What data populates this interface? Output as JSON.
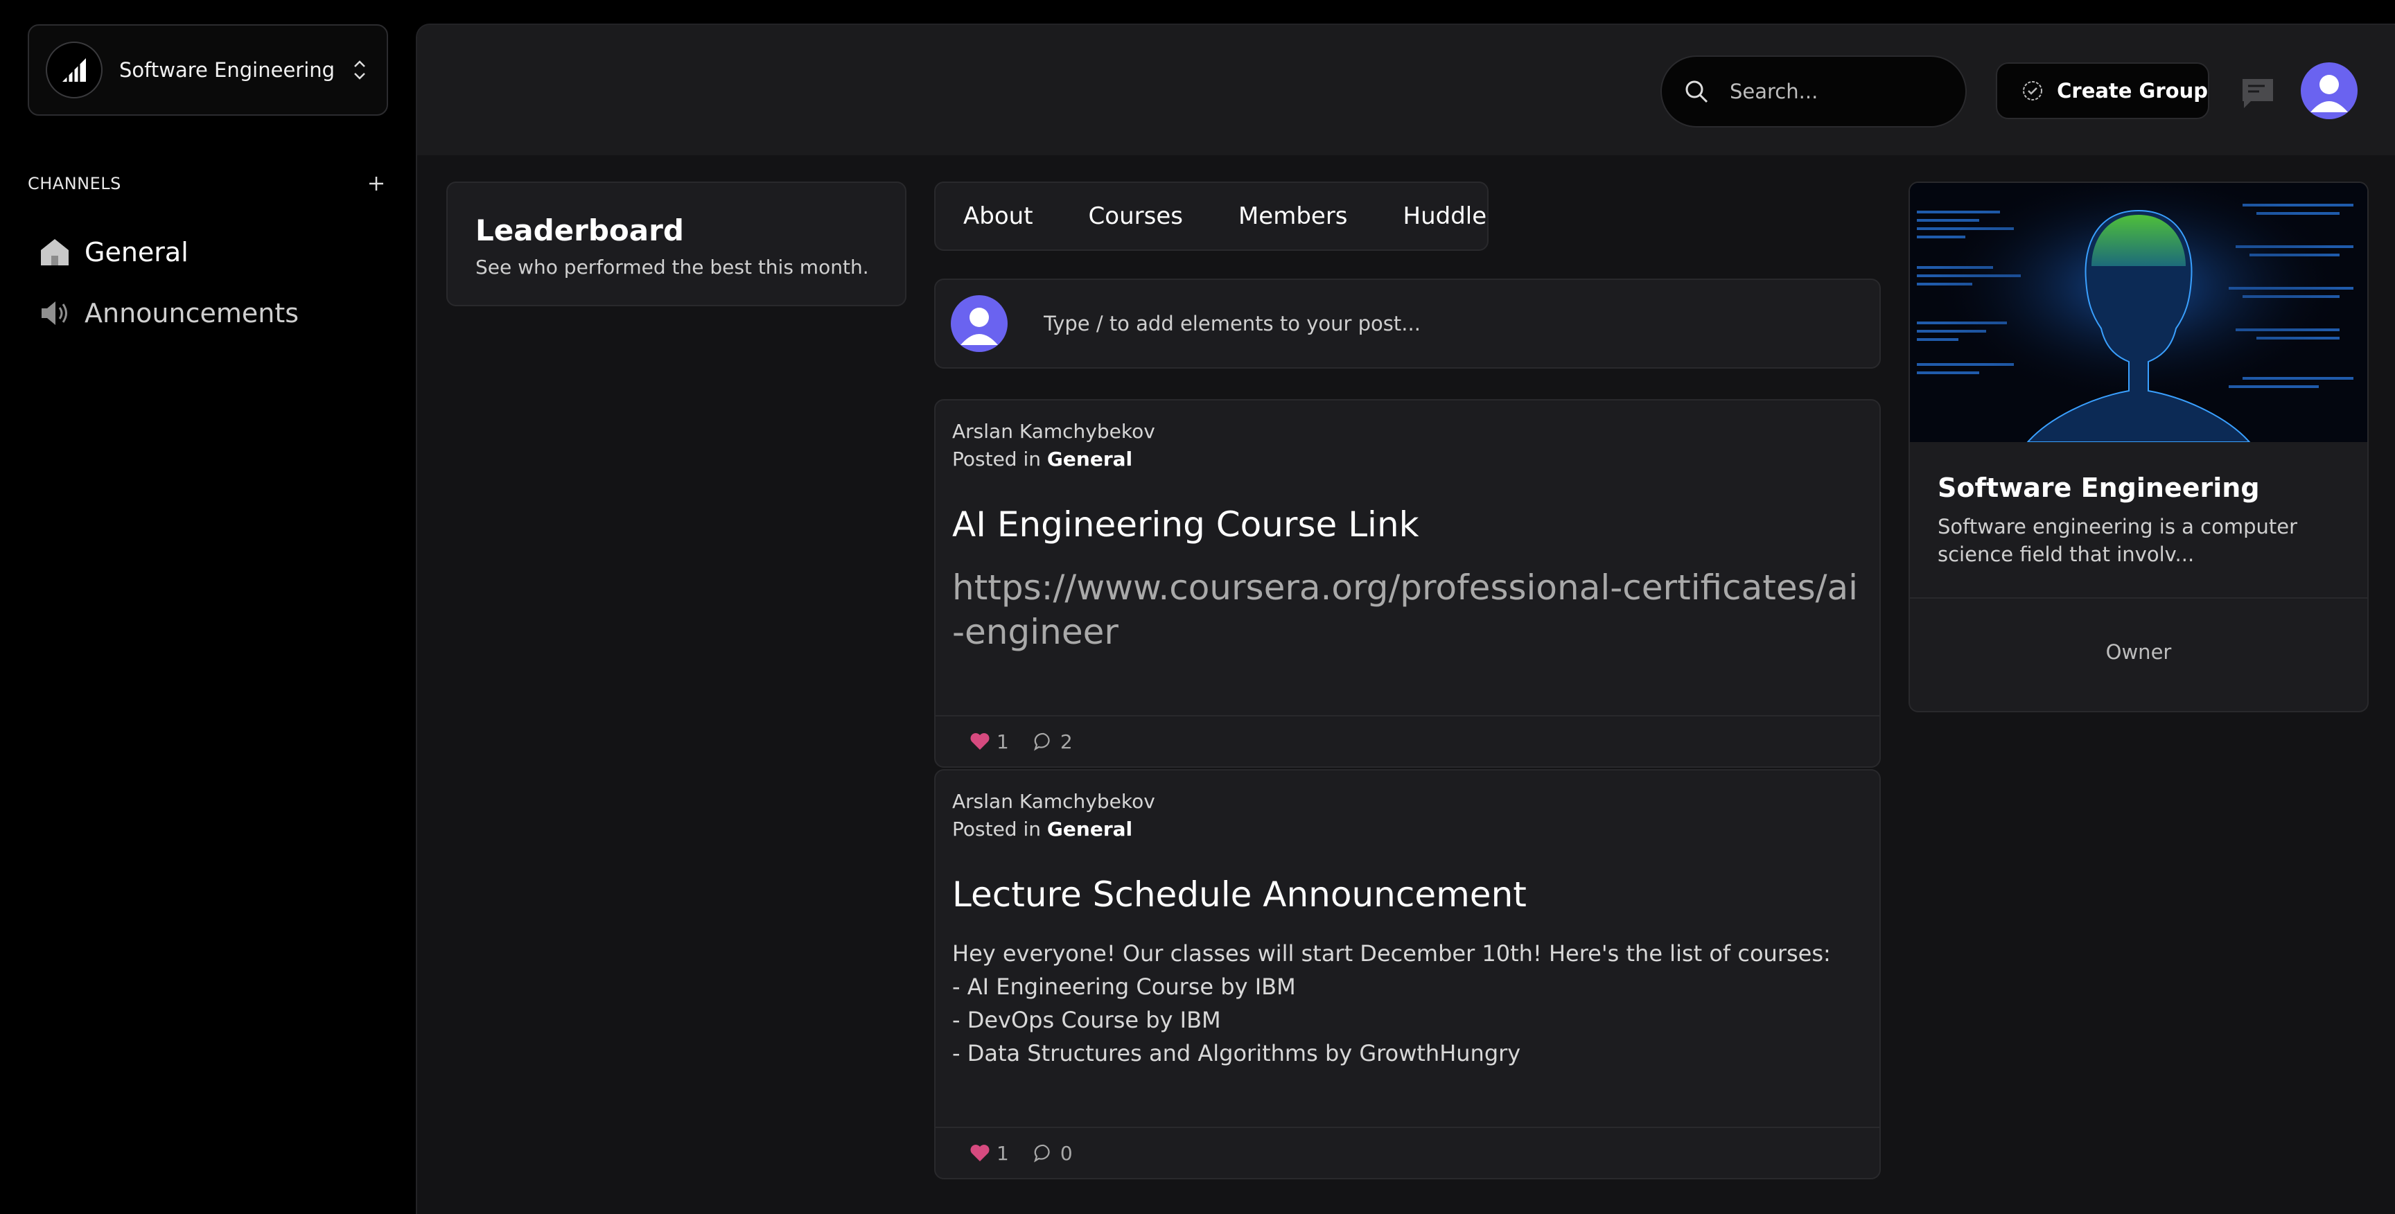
{
  "sidebar": {
    "group_name": "Software Engineering",
    "channels_title": "CHANNELS",
    "channels": [
      {
        "label": "General",
        "icon": "home-icon"
      },
      {
        "label": "Announcements",
        "icon": "speaker-icon"
      }
    ]
  },
  "topbar": {
    "search_placeholder": "Search...",
    "create_group_label": "Create Group"
  },
  "leaderboard": {
    "title": "Leaderboard",
    "subtitle": "See who performed the best this month."
  },
  "tabs": [
    "About",
    "Courses",
    "Members",
    "Huddle"
  ],
  "composer": {
    "placeholder": "Type / to add elements to your post..."
  },
  "posts": [
    {
      "author": "Arslan Kamchybekov",
      "posted_in_prefix": "Posted in",
      "channel": "General",
      "title": "AI Engineering Course Link",
      "link": "https://www.coursera.org/professional-certificates/ai-engineer",
      "likes": "1",
      "comments": "2"
    },
    {
      "author": "Arslan Kamchybekov",
      "posted_in_prefix": "Posted in",
      "channel": "General",
      "title": "Lecture Schedule Announcement",
      "body": [
        "Hey everyone! Our classes will start December 10th! Here's the list of courses:",
        "- AI Engineering Course by IBM",
        "- DevOps Course by IBM",
        "- Data Structures and Algorithms by GrowthHungry"
      ],
      "likes": "1",
      "comments": "0"
    }
  ],
  "group_card": {
    "title": "Software Engineering",
    "description": "Software engineering is a computer science field that involv...",
    "role": "Owner"
  },
  "colors": {
    "accent_avatar": "#6a63f0",
    "heart": "#d64a7f",
    "panel": "#1c1c1f"
  }
}
